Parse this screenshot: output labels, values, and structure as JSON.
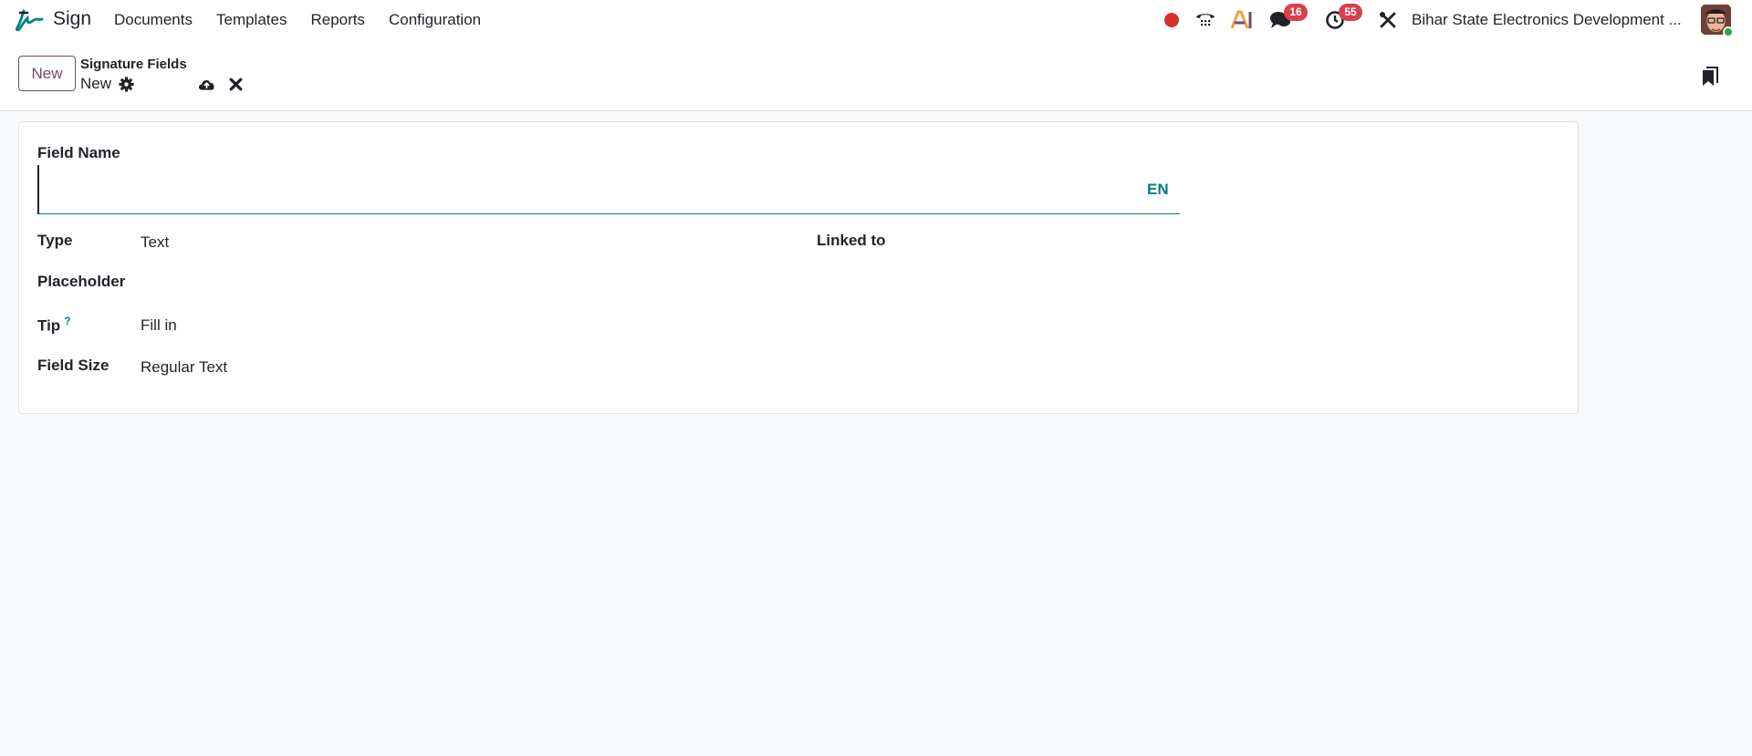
{
  "navbar": {
    "app_name": "Sign",
    "menu": [
      "Documents",
      "Templates",
      "Reports",
      "Configuration"
    ],
    "messages_count": "16",
    "activities_count": "55",
    "company": "Bihar State Electronics Development ...",
    "ai_label": "AI"
  },
  "control_panel": {
    "new_button": "New",
    "breadcrumb_parent": "Signature Fields",
    "breadcrumb_current": "New"
  },
  "form": {
    "field_name_label": "Field Name",
    "field_name_value": "",
    "lang_button": "EN",
    "type_label": "Type",
    "type_value": "Text",
    "linked_to_label": "Linked to",
    "placeholder_label": "Placeholder",
    "tip_label": "Tip",
    "tip_help": "?",
    "tip_value": "Fill in",
    "field_size_label": "Field Size",
    "field_size_value": "Regular Text"
  },
  "colors": {
    "brand": "#714b67",
    "accent": "#017e84",
    "badge": "#d8404f",
    "recording": "#d9312b"
  },
  "icons": [
    "sign-logo-icon",
    "record-dot-icon",
    "phone-icon",
    "ai-icon",
    "chat-icon",
    "clock-icon",
    "tools-icon",
    "gear-icon",
    "cloud-upload-icon",
    "close-icon",
    "bookmark-icon"
  ]
}
